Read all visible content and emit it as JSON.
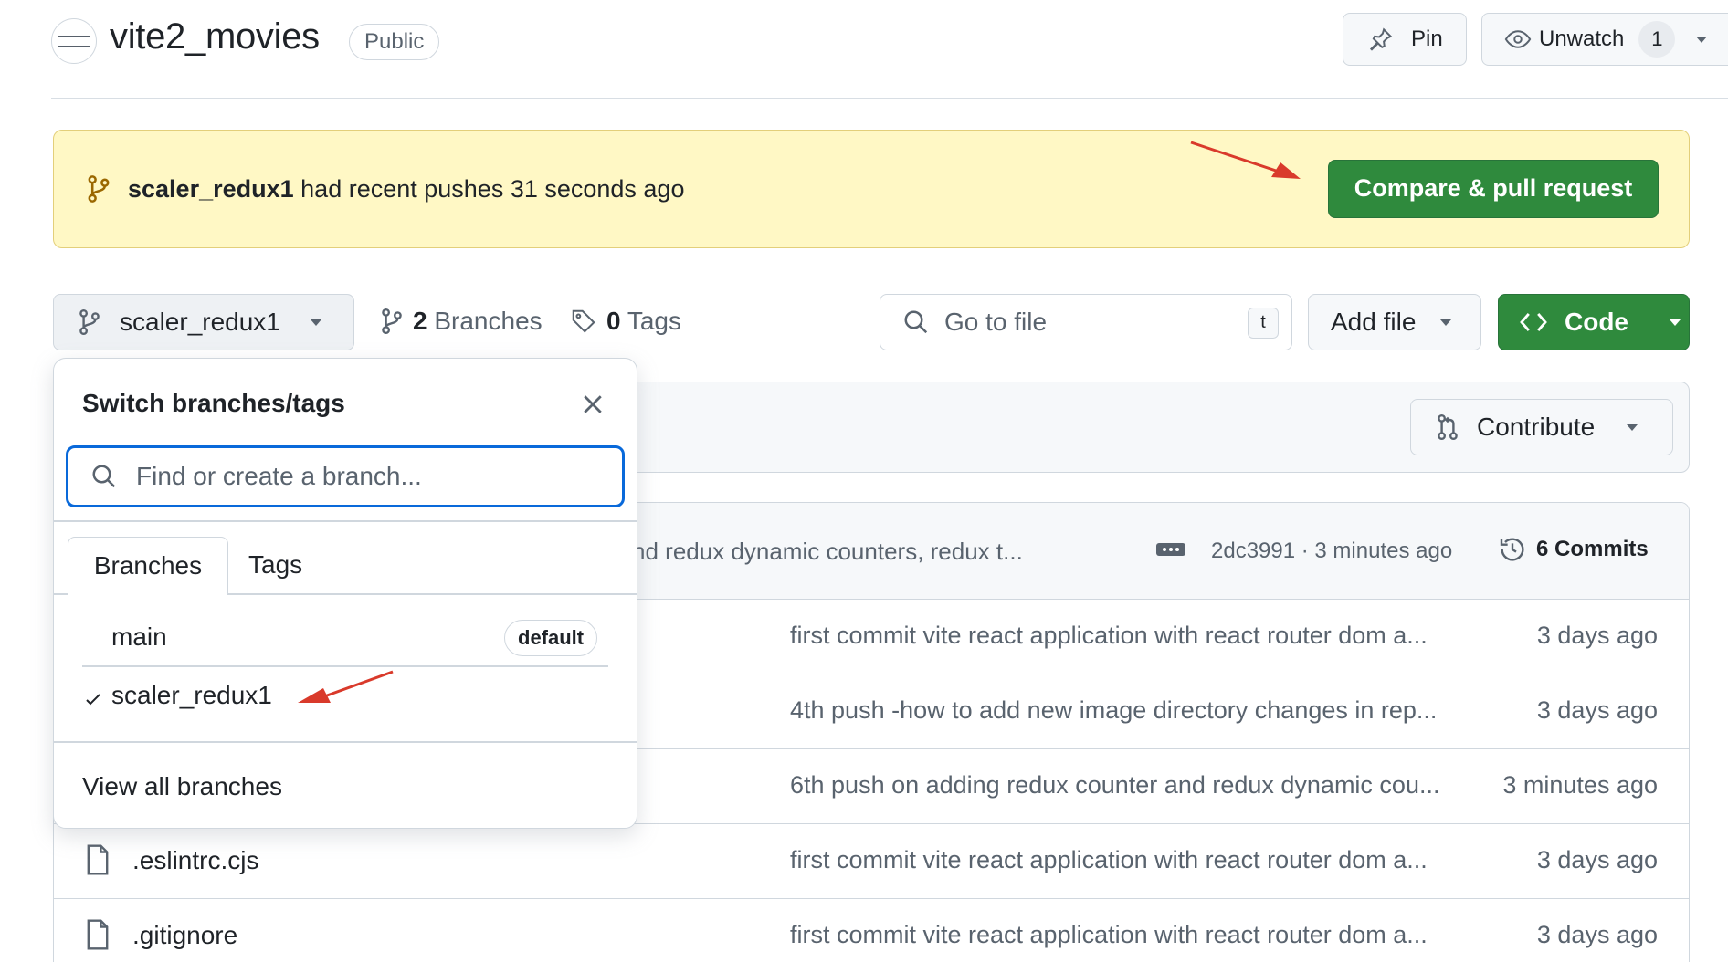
{
  "header": {
    "repo_name": "vite2_movies",
    "visibility": "Public",
    "pin_label": "Pin",
    "watch_label": "Unwatch",
    "watch_count": "1"
  },
  "banner": {
    "branch": "scaler_redux1",
    "message": "had recent pushes 31 seconds ago",
    "button_label": "Compare & pull request"
  },
  "toolbar": {
    "current_branch": "scaler_redux1",
    "branches_count": "2",
    "branches_label": "Branches",
    "tags_count": "0",
    "tags_label": "Tags",
    "search_placeholder": "Go to file",
    "search_shortcut": "t",
    "add_file_label": "Add file",
    "code_label": "Code"
  },
  "sync": {
    "contribute_label": "Contribute"
  },
  "latest_commit": {
    "message": "ter and redux dynamic counters, redux t...",
    "meta": "2dc3991 · 3 minutes ago",
    "commits_label": "6 Commits"
  },
  "files": [
    {
      "name": "",
      "message": "first commit vite react application with react router dom a...",
      "date": "3 days ago"
    },
    {
      "name": "",
      "message": "4th push -how to add new image directory changes in rep...",
      "date": "3 days ago"
    },
    {
      "name": "",
      "message": "6th push on adding redux counter and redux dynamic cou...",
      "date": "3 minutes ago"
    },
    {
      "name": ".eslintrc.cjs",
      "message": "first commit vite react application with react router dom a...",
      "date": "3 days ago"
    },
    {
      "name": ".gitignore",
      "message": "first commit vite react application with react router dom a...",
      "date": "3 days ago"
    }
  ],
  "dropdown": {
    "title": "Switch branches/tags",
    "search_placeholder": "Find or create a branch...",
    "tabs": [
      "Branches",
      "Tags"
    ],
    "branches": [
      {
        "name": "main",
        "badge": "default",
        "selected": false
      },
      {
        "name": "scaler_redux1",
        "badge": "",
        "selected": true
      }
    ],
    "view_all_label": "View all branches"
  },
  "colors": {
    "primary_green": "#2f8a3d",
    "banner_bg": "#fff8c5",
    "focus_blue": "#0969da",
    "annotation_red": "#d93a2b"
  },
  "icons": [
    "pin-icon",
    "eye-icon",
    "branch-icon",
    "tag-icon",
    "search-icon",
    "code-icon",
    "contribute-icon",
    "history-icon",
    "file-icon",
    "close-icon",
    "check-icon",
    "caret-down-icon",
    "arrow-annotation"
  ]
}
